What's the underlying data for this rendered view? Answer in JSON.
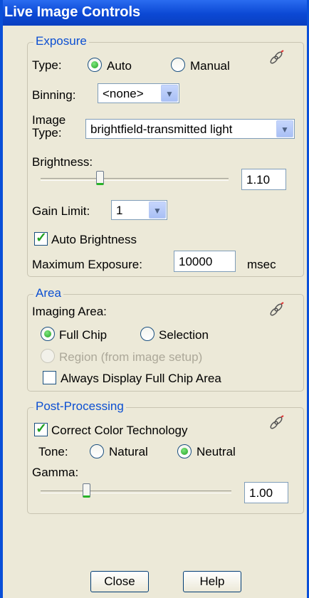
{
  "window": {
    "title": "Live Image Controls"
  },
  "exposure": {
    "group_label": "Exposure",
    "type_label": "Type:",
    "type_auto": "Auto",
    "type_manual": "Manual",
    "type_selected": "Auto",
    "binning_label": "Binning:",
    "binning_value": "<none>",
    "image_type_label_line1": "Image",
    "image_type_label_line2": "Type:",
    "image_type_value": "brightfield-transmitted light",
    "brightness_label": "Brightness:",
    "brightness_value": "1.10",
    "gain_limit_label": "Gain Limit:",
    "gain_limit_value": "1",
    "auto_brightness_label": "Auto Brightness",
    "auto_brightness_checked": true,
    "max_exposure_label": "Maximum Exposure:",
    "max_exposure_value": "10000",
    "max_exposure_unit": "msec"
  },
  "area": {
    "group_label": "Area",
    "imaging_area_label": "Imaging Area:",
    "full_chip": "Full Chip",
    "selection": "Selection",
    "region": "Region (from image setup)",
    "selected": "Full Chip",
    "always_display_label": "Always Display Full Chip Area",
    "always_display_checked": false
  },
  "post_processing": {
    "group_label": "Post-Processing",
    "correct_color_label": "Correct Color Technology",
    "correct_color_checked": true,
    "tone_label": "Tone:",
    "tone_natural": "Natural",
    "tone_neutral": "Neutral",
    "tone_selected": "Neutral",
    "gamma_label": "Gamma:",
    "gamma_value": "1.00"
  },
  "buttons": {
    "close": "Close",
    "help": "Help"
  },
  "icons": {
    "link": "link-icon",
    "dropdown": "chevron-down-icon"
  },
  "colors": {
    "title_bar": "#0a4fd8",
    "group_label": "#0b4fd2",
    "radio_on": "#21a121"
  }
}
